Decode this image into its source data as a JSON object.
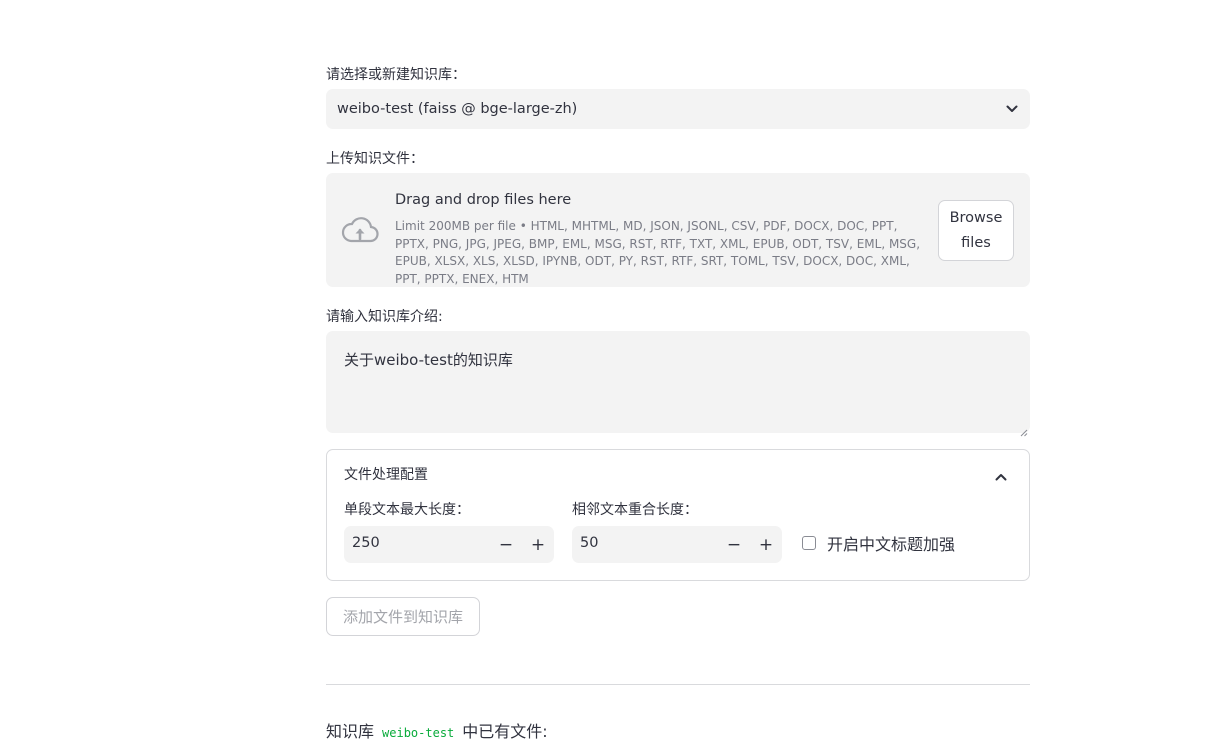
{
  "kb_select": {
    "label": "请选择或新建知识库：",
    "value": "weibo-test (faiss @ bge-large-zh)"
  },
  "uploader": {
    "label": "上传知识文件：",
    "drop_title": "Drag and drop files here",
    "limit_text": "Limit 200MB per file • HTML, MHTML, MD, JSON, JSONL, CSV, PDF, DOCX, DOC, PPT, PPTX, PNG, JPG, JPEG, BMP, EML, MSG, RST, RTF, TXT, XML, EPUB, ODT, TSV, EML, MSG, EPUB, XLSX, XLS, XLSD, IPYNB, ODT, PY, RST, RTF, SRT, TOML, TSV, DOCX, DOC, XML, PPT, PPTX, ENEX, HTM",
    "browse_label": "Browse files",
    "icon": "cloud-upload-icon"
  },
  "intro": {
    "label": "请输入知识库介绍:",
    "value": "关于weibo-test的知识库"
  },
  "config": {
    "title": "文件处理配置",
    "max_len": {
      "label": "单段文本最大长度：",
      "value": "250"
    },
    "overlap": {
      "label": "相邻文本重合长度：",
      "value": "50"
    },
    "minus": "−",
    "plus": "+",
    "zh_title_enhance": {
      "label": "开启中文标题加强",
      "checked": false
    }
  },
  "add_button": "添加文件到知识库",
  "footer": {
    "prefix": "知识库",
    "kb_name": "weibo-test",
    "suffix": "中已有文件:"
  },
  "colors": {
    "input_bg": "#f3f3f3",
    "text": "#31333f",
    "muted": "#7a7c86",
    "code_green": "#09ab3b",
    "border": "#d9dadd"
  }
}
